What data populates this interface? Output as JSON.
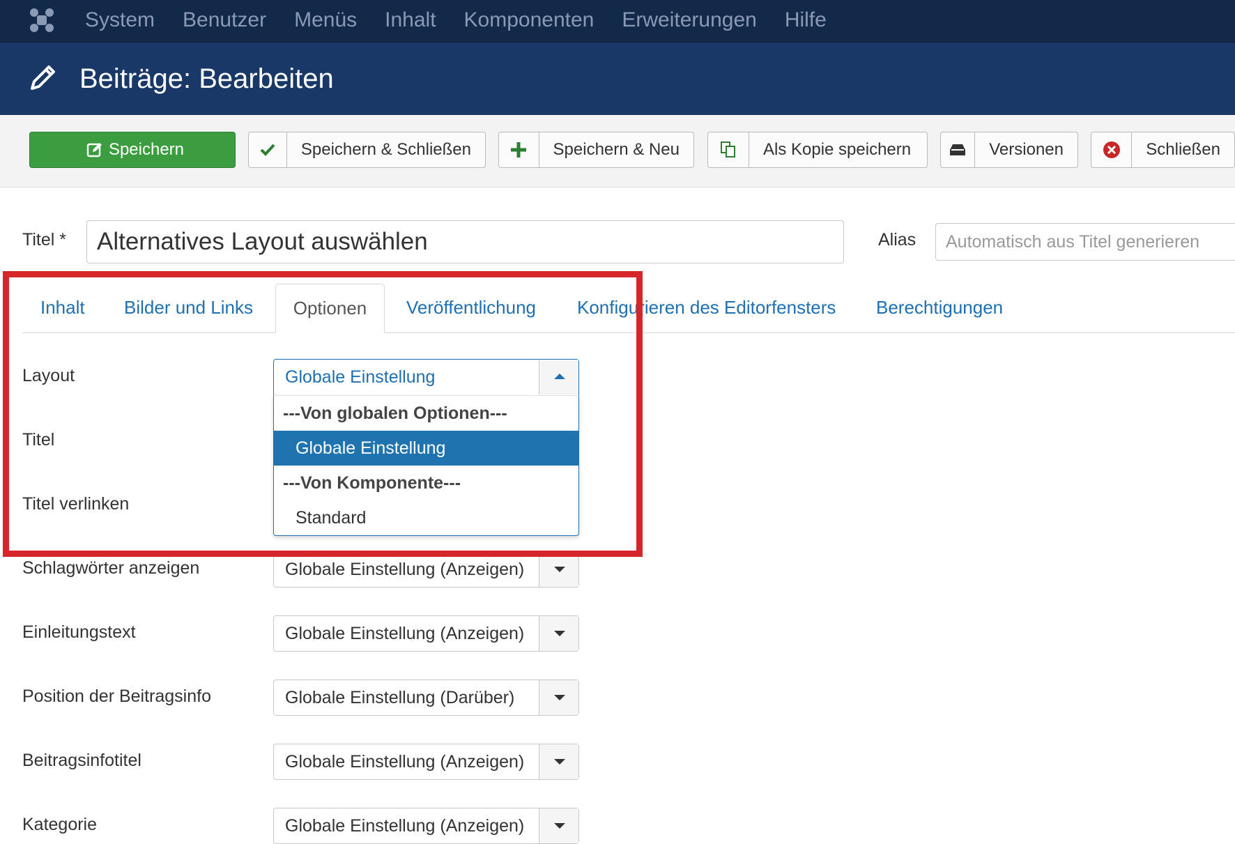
{
  "topnav": {
    "logo_icon": "joomla-logo-icon",
    "items": [
      "System",
      "Benutzer",
      "Menüs",
      "Inhalt",
      "Komponenten",
      "Erweiterungen",
      "Hilfe"
    ]
  },
  "header": {
    "title": "Beiträge: Bearbeiten",
    "icon": "pencil-icon"
  },
  "toolbar": {
    "save": "Speichern",
    "save_close": "Speichern & Schließen",
    "save_new": "Speichern & Neu",
    "save_copy": "Als Kopie speichern",
    "versions": "Versionen",
    "close": "Schließen"
  },
  "form": {
    "title_label": "Titel *",
    "title_value": "Alternatives Layout auswählen",
    "alias_label": "Alias",
    "alias_placeholder": "Automatisch aus Titel generieren"
  },
  "tabs": [
    "Inhalt",
    "Bilder und Links",
    "Optionen",
    "Veröffentlichung",
    "Konfigurieren des Editorfensters",
    "Berechtigungen"
  ],
  "options": {
    "layout": {
      "label": "Layout",
      "value": "Globale Einstellung",
      "dropdown": {
        "group1": "---Von globalen Optionen---",
        "opt1": "Globale Einstellung",
        "group2": "---Von Komponente---",
        "opt2": "Standard"
      }
    },
    "rows": [
      {
        "label": "Titel"
      },
      {
        "label": "Titel verlinken"
      },
      {
        "label": "Schlagwörter anzeigen",
        "value": "Globale Einstellung (Anzeigen)"
      },
      {
        "label": "Einleitungstext",
        "value": "Globale Einstellung (Anzeigen)"
      },
      {
        "label": "Position der Beitragsinfo",
        "value": "Globale Einstellung (Darüber)"
      },
      {
        "label": "Beitragsinfotitel",
        "value": "Globale Einstellung (Anzeigen)"
      },
      {
        "label": "Kategorie",
        "value": "Globale Einstellung (Anzeigen)"
      }
    ]
  },
  "colors": {
    "topnav": "#13294a",
    "header": "#1a3867",
    "save_green": "#3b9d40",
    "link_blue": "#1f6fb2",
    "highlight_red": "#d7262a"
  }
}
